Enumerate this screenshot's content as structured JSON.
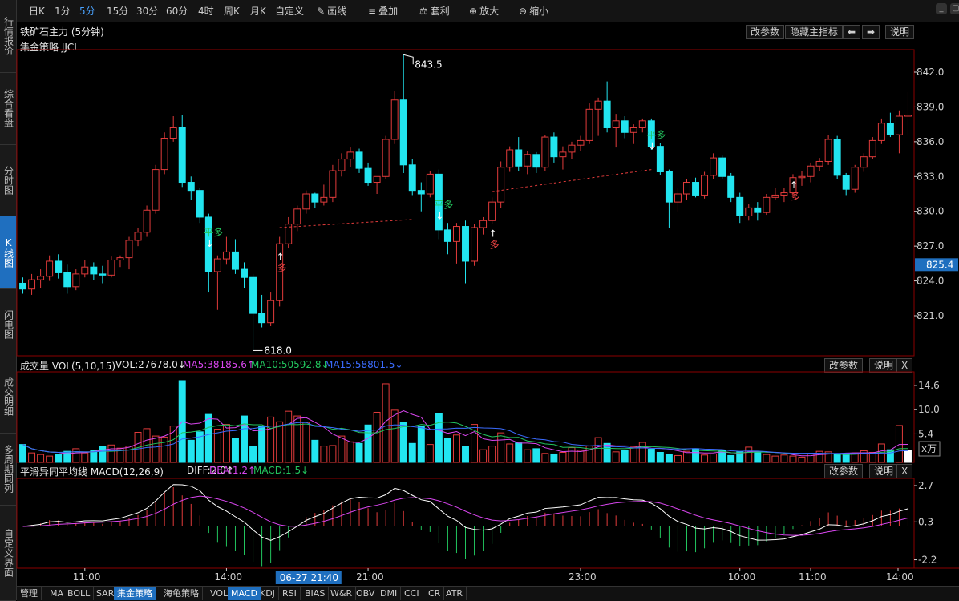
{
  "sidebar": [
    {
      "label": "行情报价",
      "name": "sidebar-item-quotes"
    },
    {
      "label": "综合看盘",
      "name": "sidebar-item-overview"
    },
    {
      "label": "分时图",
      "name": "sidebar-item-timeshare"
    },
    {
      "label": "K线图",
      "name": "sidebar-item-kline",
      "active": true
    },
    {
      "label": "闪电图",
      "name": "sidebar-item-flash"
    },
    {
      "label": "成交明细",
      "name": "sidebar-item-trades"
    },
    {
      "label": "多周期同列",
      "name": "sidebar-item-multi-period"
    },
    {
      "label": "自定义界面",
      "name": "sidebar-item-custom-layout"
    }
  ],
  "toolbar": {
    "periods": [
      "日K",
      "1分",
      "5分",
      "15分",
      "30分",
      "60分",
      "4时",
      "周K",
      "月K",
      "自定义"
    ],
    "active_period": "5分",
    "tools": [
      {
        "label": "画线",
        "icon": "pencil-icon",
        "glyph": "✎"
      },
      {
        "label": "叠加",
        "icon": "layers-icon",
        "glyph": "≡"
      },
      {
        "label": "套利",
        "icon": "arbitrage-icon",
        "glyph": "⚖"
      },
      {
        "label": "放大",
        "icon": "zoom-in-icon",
        "glyph": "⊕"
      },
      {
        "label": "缩小",
        "icon": "zoom-out-icon",
        "glyph": "⊖"
      }
    ]
  },
  "main_panel": {
    "title": "铁矿石主力 (5分钟)",
    "strategy": "集金策略 JJCL",
    "buttons": {
      "params": "改参数",
      "hide": "隐藏主指标",
      "prev": "⬅",
      "next": "➡",
      "help": "说明"
    },
    "high_label": "843.5",
    "low_label": "818.0",
    "current_price": "825.4",
    "y_ticks": [
      "842.0",
      "839.0",
      "836.0",
      "833.0",
      "830.0",
      "827.0",
      "824.0",
      "821.0"
    ],
    "signals": [
      {
        "text": "平多",
        "color": "#22c55e"
      },
      {
        "text": "多",
        "color": "#ef4444"
      },
      {
        "text": "平多",
        "color": "#22c55e"
      },
      {
        "text": "多",
        "color": "#ef4444"
      },
      {
        "text": "平多",
        "color": "#22c55e"
      },
      {
        "text": "多",
        "color": "#ef4444"
      }
    ]
  },
  "volume_panel": {
    "title": "成交量 VOL(5,10,15)",
    "vol": "VOL:27678.0↓",
    "ma5": "MA5:38185.6↑",
    "ma10": "MA10:50592.8↓",
    "ma15": "MA15:58801.5↓",
    "ma5_color": "#d946ef",
    "ma10_color": "#22c55e",
    "ma15_color": "#3b6cff",
    "y_ticks": [
      "14.6",
      "10.0",
      "5.4"
    ],
    "unit_button": "x万",
    "buttons": {
      "params": "改参数",
      "help": "说明",
      "close": "X"
    }
  },
  "macd_panel": {
    "title": "平滑异同平均线 MACD(12,26,9)",
    "diff": "DIFF:2.0↑",
    "dea": "DEA:1.2↑",
    "macd": "MACD:1.5↓",
    "dea_color": "#d946ef",
    "macd_color": "#22c55e",
    "y_ticks": [
      "2.7",
      "0.3",
      "-2.2"
    ],
    "buttons": {
      "params": "改参数",
      "help": "说明",
      "close": "X"
    }
  },
  "time_axis": {
    "labels": [
      "11:00",
      "14:00",
      "21:00",
      "23:00",
      "10:00",
      "11:00",
      "14:00"
    ],
    "cursor": "06-27 21:40"
  },
  "bottom_tabs": [
    "管理",
    "MA",
    "BOLL",
    "SAR",
    "集金策略",
    "海龟策略",
    "VOL",
    "MACD",
    "KDJ",
    "RSI",
    "BIAS",
    "W&R",
    "OBV",
    "DMI",
    "CCI",
    "CR",
    "ATR"
  ],
  "bottom_tabs_active": [
    "集金策略",
    "MACD"
  ],
  "colors": {
    "up": "#e23b3b",
    "down": "#22e5f0",
    "grid": "#8b0000",
    "axis": "#cfcfcf"
  },
  "chart_data": {
    "type": "candlestick",
    "title": "铁矿石主力 (5分钟)",
    "ylim": [
      818.0,
      843.5
    ],
    "ohlc": [
      [
        823.8,
        824.3,
        822.9,
        823.3
      ],
      [
        823.3,
        824.6,
        822.8,
        824.1
      ],
      [
        824.1,
        825.0,
        823.4,
        824.4
      ],
      [
        824.4,
        826.2,
        824.0,
        825.7
      ],
      [
        825.7,
        826.3,
        824.2,
        824.7
      ],
      [
        824.7,
        825.4,
        822.9,
        823.5
      ],
      [
        823.5,
        825.0,
        823.2,
        824.6
      ],
      [
        824.6,
        825.8,
        824.3,
        825.2
      ],
      [
        825.2,
        825.6,
        824.1,
        824.6
      ],
      [
        824.6,
        825.3,
        823.8,
        824.5
      ],
      [
        824.5,
        826.1,
        824.3,
        825.8
      ],
      [
        825.8,
        826.2,
        825.2,
        826.0
      ],
      [
        826.0,
        827.8,
        825.0,
        827.5
      ],
      [
        827.5,
        828.6,
        827.0,
        828.2
      ],
      [
        828.2,
        830.5,
        827.8,
        830.1
      ],
      [
        830.1,
        834.0,
        829.8,
        833.6
      ],
      [
        833.6,
        836.8,
        833.2,
        836.3
      ],
      [
        836.3,
        838.2,
        836.0,
        837.2
      ],
      [
        837.2,
        838.3,
        832.1,
        832.5
      ],
      [
        832.5,
        833.0,
        831.0,
        831.8
      ],
      [
        831.8,
        832.0,
        829.0,
        829.5
      ],
      [
        829.5,
        829.8,
        823.0,
        824.8
      ],
      [
        824.8,
        826.2,
        821.5,
        825.9
      ],
      [
        825.9,
        827.8,
        825.4,
        826.5
      ],
      [
        826.5,
        827.6,
        824.6,
        825.0
      ],
      [
        825.0,
        825.6,
        823.4,
        824.3
      ],
      [
        824.3,
        824.6,
        818.0,
        821.2
      ],
      [
        821.2,
        822.8,
        820.0,
        820.4
      ],
      [
        820.4,
        823.0,
        820.1,
        822.3
      ],
      [
        822.3,
        827.8,
        821.8,
        827.2
      ],
      [
        827.2,
        829.5,
        826.8,
        828.9
      ],
      [
        828.9,
        830.5,
        828.3,
        830.2
      ],
      [
        830.2,
        831.8,
        829.8,
        831.5
      ],
      [
        831.5,
        831.6,
        830.3,
        830.8
      ],
      [
        830.8,
        832.3,
        830.5,
        831.2
      ],
      [
        831.2,
        834.0,
        830.8,
        833.5
      ],
      [
        833.5,
        835.0,
        833.0,
        834.5
      ],
      [
        834.5,
        835.5,
        833.8,
        835.1
      ],
      [
        835.1,
        835.4,
        833.3,
        833.7
      ],
      [
        833.7,
        834.2,
        832.2,
        832.5
      ],
      [
        832.5,
        833.0,
        831.5,
        833.0
      ],
      [
        833.0,
        836.5,
        832.8,
        836.2
      ],
      [
        836.2,
        840.4,
        835.8,
        839.6
      ],
      [
        839.6,
        843.5,
        833.3,
        834.0
      ],
      [
        834.0,
        834.5,
        831.4,
        831.8
      ],
      [
        831.8,
        832.5,
        830.0,
        831.5
      ],
      [
        831.5,
        833.5,
        831.2,
        833.2
      ],
      [
        833.2,
        833.6,
        827.6,
        828.4
      ],
      [
        828.4,
        829.0,
        826.3,
        827.4
      ],
      [
        827.4,
        829.0,
        825.5,
        828.7
      ],
      [
        828.7,
        829.2,
        823.8,
        825.7
      ],
      [
        825.7,
        828.9,
        825.3,
        828.6
      ],
      [
        828.6,
        829.5,
        828.0,
        829.2
      ],
      [
        829.2,
        831.2,
        828.9,
        830.8
      ],
      [
        830.8,
        834.3,
        830.3,
        833.8
      ],
      [
        833.8,
        835.6,
        833.4,
        835.3
      ],
      [
        835.3,
        836.4,
        833.5,
        833.9
      ],
      [
        833.9,
        835.2,
        833.2,
        834.9
      ],
      [
        834.9,
        835.1,
        833.3,
        833.8
      ],
      [
        833.8,
        836.6,
        833.5,
        836.4
      ],
      [
        836.4,
        836.8,
        834.2,
        834.7
      ],
      [
        834.7,
        835.6,
        833.6,
        835.1
      ],
      [
        835.1,
        836.0,
        834.5,
        835.7
      ],
      [
        835.7,
        836.5,
        835.2,
        836.1
      ],
      [
        836.1,
        839.3,
        835.8,
        838.8
      ],
      [
        838.8,
        839.8,
        836.5,
        839.5
      ],
      [
        839.5,
        841.2,
        836.8,
        837.2
      ],
      [
        837.2,
        838.4,
        835.5,
        837.8
      ],
      [
        837.8,
        838.2,
        836.3,
        836.8
      ],
      [
        836.8,
        837.5,
        835.8,
        837.2
      ],
      [
        837.2,
        838.0,
        836.8,
        837.8
      ],
      [
        837.8,
        838.0,
        835.3,
        835.6
      ],
      [
        835.6,
        835.9,
        833.1,
        833.4
      ],
      [
        833.4,
        833.6,
        828.6,
        830.8
      ],
      [
        830.8,
        832.0,
        830.0,
        831.5
      ],
      [
        831.5,
        832.8,
        831.0,
        832.5
      ],
      [
        832.5,
        832.9,
        831.2,
        831.4
      ],
      [
        831.4,
        833.4,
        831.1,
        833.1
      ],
      [
        833.1,
        835.0,
        832.8,
        834.6
      ],
      [
        834.6,
        834.8,
        832.8,
        833.0
      ],
      [
        833.0,
        833.3,
        830.8,
        831.2
      ],
      [
        831.2,
        831.6,
        829.0,
        829.6
      ],
      [
        829.6,
        830.6,
        829.2,
        830.3
      ],
      [
        830.3,
        830.8,
        829.2,
        829.9
      ],
      [
        829.9,
        831.5,
        829.7,
        831.2
      ],
      [
        831.2,
        832.0,
        831.0,
        831.4
      ],
      [
        831.4,
        832.0,
        830.8,
        831.6
      ],
      [
        831.6,
        833.2,
        831.2,
        832.9
      ],
      [
        832.9,
        833.5,
        832.2,
        833.0
      ],
      [
        833.0,
        834.2,
        832.5,
        833.9
      ],
      [
        833.9,
        834.6,
        833.5,
        834.3
      ],
      [
        834.3,
        836.6,
        834.0,
        836.2
      ],
      [
        836.2,
        836.5,
        832.8,
        833.1
      ],
      [
        833.1,
        833.3,
        831.4,
        831.9
      ],
      [
        831.9,
        834.0,
        831.6,
        833.8
      ],
      [
        833.8,
        835.0,
        833.4,
        834.7
      ],
      [
        834.7,
        836.4,
        834.5,
        836.1
      ],
      [
        836.1,
        838.0,
        835.8,
        837.6
      ],
      [
        837.6,
        838.5,
        836.4,
        836.6
      ],
      [
        836.6,
        838.7,
        835.0,
        838.2
      ],
      [
        838.2,
        840.3,
        836.5,
        838.3
      ]
    ],
    "volume": [
      3.4,
      1.8,
      1.5,
      1.2,
      1.6,
      2.1,
      2.6,
      1.8,
      2.2,
      3.0,
      3.3,
      2.7,
      3.1,
      5.7,
      6.4,
      5.0,
      4.8,
      6.9,
      15.5,
      4.2,
      5.8,
      9.1,
      6.3,
      7.2,
      4.6,
      8.8,
      3.0,
      6.9,
      8.6,
      7.7,
      9.7,
      8.8,
      7.6,
      4.2,
      3.1,
      3.2,
      5.0,
      3.9,
      3.6,
      7.1,
      9.5,
      14.9,
      9.9,
      7.6,
      3.6,
      6.8,
      3.4,
      9.2,
      4.6,
      5.2,
      3.0,
      7.2,
      2.4,
      3.1,
      5.6,
      3.5,
      3.7,
      2.4,
      2.6,
      1.7,
      1.6,
      1.9,
      2.8,
      2.3,
      3.1,
      4.7,
      3.6,
      2.0,
      2.3,
      2.9,
      3.8,
      2.5,
      1.9,
      1.5,
      1.3,
      2.1,
      2.6,
      1.4,
      1.6,
      2.3,
      1.3,
      2.0,
      2.9,
      2.0,
      1.5,
      1.2,
      1.4,
      1.2,
      1.0,
      1.6,
      2.1,
      2.0,
      1.6,
      1.5,
      1.8,
      2.2,
      1.9,
      3.5,
      2.4,
      7.0,
      2.3
    ],
    "signal_y": {
      "high": 843.5,
      "low": 818.0
    }
  }
}
